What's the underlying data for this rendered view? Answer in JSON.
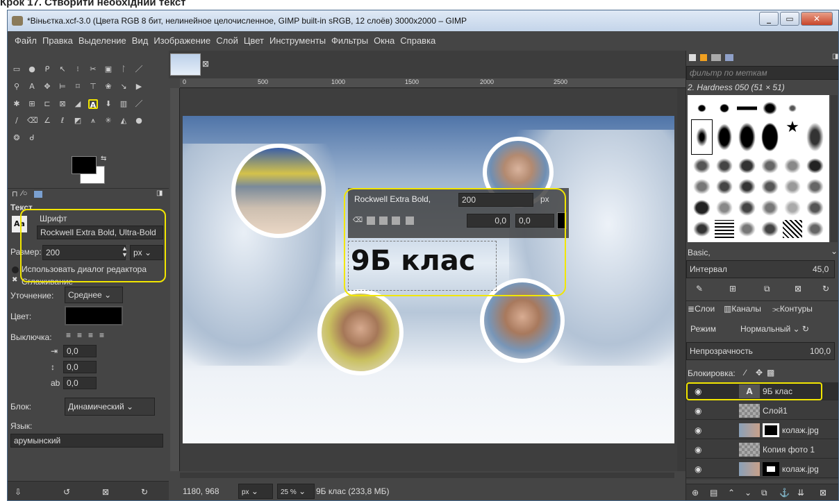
{
  "caption": "Крок 17. Створити необхідний текст",
  "window": {
    "title": "*Віньєтка.xcf-3.0 (Цвета RGB 8 бит, нелинейное целочисленное, GIMP built-in sRGB, 12 слоёв) 3000x2000 – GIMP"
  },
  "menu": [
    "Файл",
    "Правка",
    "Выделение",
    "Вид",
    "Изображение",
    "Слой",
    "Цвет",
    "Инструменты",
    "Фильтры",
    "Окна",
    "Справка"
  ],
  "tool_options": {
    "header": "Текст",
    "font_label": "Шрифт",
    "font_value": "Rockwell Extra Bold, Ultra-Bold",
    "size_label": "Размер:",
    "size_value": "200",
    "size_unit": "px",
    "use_editor": "Использовать диалог редактора",
    "antialias": "Сглаживание",
    "hinting_label": "Уточнение:",
    "hinting_value": "Среднее",
    "color_label": "Цвет:",
    "justify_label": "Выключка:",
    "indent": "0,0",
    "line_spacing": "0,0",
    "letter_spacing": "0,0",
    "box_label": "Блок:",
    "box_value": "Динамический",
    "lang_label": "Язык:",
    "lang_value": "арумынский"
  },
  "ruler": {
    "ticks": [
      "0",
      "500",
      "1000",
      "1500",
      "2000",
      "2500"
    ]
  },
  "canvas": {
    "text_layer": "9Б клас",
    "overlay_font": "Rockwell Extra Bold",
    "overlay_size": "200",
    "overlay_unit": "px",
    "overlay_baseline": "0,0",
    "overlay_kerning": "0,0"
  },
  "statusbar": {
    "coords": "1180, 968",
    "unit": "px",
    "zoom": "25 %",
    "info": "9Б клас (233,8 МБ)"
  },
  "brushes": {
    "filter_placeholder": "фильтр по меткам",
    "current": "2. Hardness 050 (51 × 51)",
    "preset": "Basic,",
    "spacing_label": "Интервал",
    "spacing_value": "45,0"
  },
  "layers": {
    "tabs": [
      "Слои",
      "Каналы",
      "Контуры"
    ],
    "mode_label": "Режим",
    "mode_value": "Нормальный",
    "opacity_label": "Непрозрачность",
    "opacity_value": "100,0",
    "lock_label": "Блокировка:",
    "items": [
      "9Б клас",
      "Слой1",
      "колаж.jpg",
      "Копия фото 1",
      "колаж.jpg"
    ]
  },
  "colors": {
    "highlight": "#f2e600",
    "panel": "#454545",
    "dark": "#303030"
  }
}
